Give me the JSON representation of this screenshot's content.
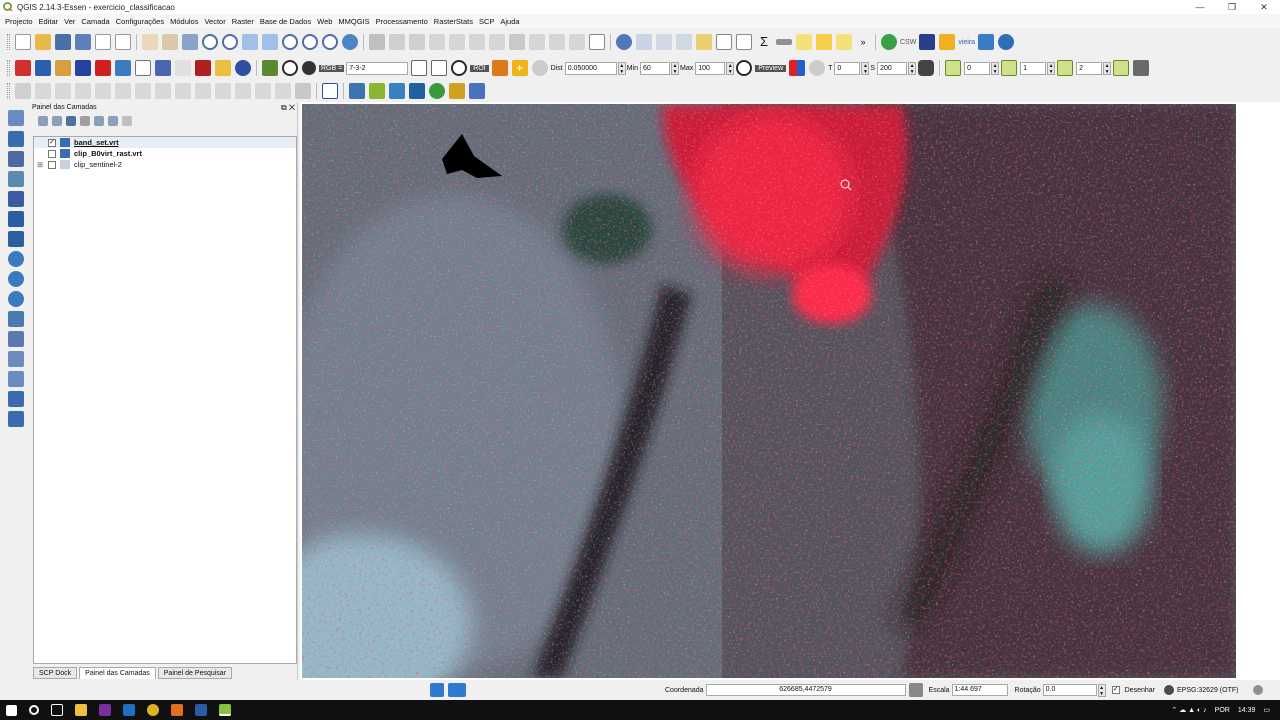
{
  "window": {
    "title": "QGIS 2.14.3-Essen - exercicio_classificacao",
    "minimize": "—",
    "restore": "❐",
    "close": "✕"
  },
  "menu": [
    "Projecto",
    "Editar",
    "Ver",
    "Camada",
    "Configurações",
    "Módulos",
    "Vector",
    "Raster",
    "Base de Dados",
    "Web",
    "MMQGIS",
    "Processamento",
    "RasterStats",
    "SCP",
    "Ajuda"
  ],
  "scp_toolbar": {
    "rgb_label": "RGB =",
    "rgb_value": "7-3-2",
    "roi_label": "ROI",
    "dist_label": "Dist",
    "dist_value": "0.050000",
    "min_label": "Min",
    "min_value": "60",
    "max_label": "Max",
    "max_value": "100",
    "preview_label": "Preview",
    "t_label": "T",
    "t_value": "0",
    "s_label": "S",
    "s_value": "200",
    "field1_value": "0",
    "field2_value": "1",
    "field3_value": "2"
  },
  "web_toolbar": {
    "csw_label": "CSW",
    "vieira_label": "vieira"
  },
  "layers_panel": {
    "title": "Painel das Camadas",
    "layers": [
      {
        "name": "band_set.vrt",
        "checked": true
      },
      {
        "name": "clip_B0virt_rast.vrt",
        "checked": false
      },
      {
        "name": "clip_sentinel-2",
        "checked": false
      }
    ],
    "tabs": [
      "SCP Dock",
      "Painel das Camadas",
      "Painel de Pesquisar"
    ]
  },
  "status": {
    "coord_label": "Coordenada",
    "coord_value": "626685,4472579",
    "scale_label": "Escala",
    "scale_value": "1:44 697",
    "rotation_label": "Rotação",
    "rotation_value": "0.0",
    "render_label": "Desenhar",
    "crs": "EPSG:32629 (OTF)"
  },
  "taskbar": {
    "lang": "POR",
    "time": "14:39"
  },
  "colors": {
    "vegetation_red": "#e0102e",
    "water_cyan": "#3e9c9a",
    "urban": "#9fb8c0",
    "dark_terrain": "#2a2227"
  }
}
